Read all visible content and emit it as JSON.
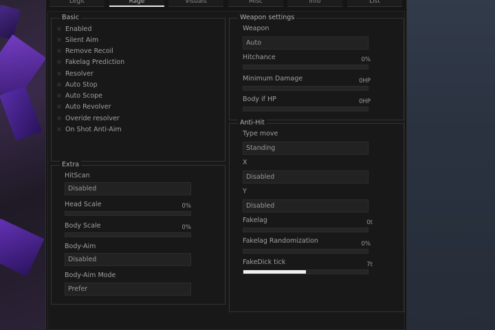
{
  "tabs": [
    "Legit",
    "Rage",
    "Visuals",
    "Misc",
    "Info",
    "List"
  ],
  "active_tab": "Rage",
  "basic": {
    "title": "Basic",
    "items": [
      "Enabled",
      "Silent Aim",
      "Remove Recoil",
      "Fakelag Prediction",
      "Resolver",
      "Auto Stop",
      "Auto Scope",
      "Auto Revolver",
      "Overide resolver",
      "On Shot Anti-Aim"
    ]
  },
  "extra": {
    "title": "Extra",
    "hitscan_label": "HitScan",
    "hitscan_value": "Disabled",
    "head_scale_label": "Head Scale",
    "head_scale_value": "0%",
    "head_scale_fraction": 0,
    "body_scale_label": "Body Scale",
    "body_scale_value": "0%",
    "body_scale_fraction": 0,
    "body_aim_label": "Body-Aim",
    "body_aim_value": "Disabled",
    "body_aim_mode_label": "Body-Aim Mode",
    "body_aim_mode_value": "Prefer"
  },
  "weapon": {
    "title": "Weapon settings",
    "weapon_label": "Weapon",
    "weapon_value": "Auto",
    "hitchance_label": "Hitchance",
    "hitchance_value": "0%",
    "hitchance_fraction": 0,
    "min_damage_label": "Minimum Damage",
    "min_damage_value": "0HP",
    "min_damage_fraction": 0,
    "body_if_hp_label": "Body if HP",
    "body_if_hp_value": "0HP",
    "body_if_hp_fraction": 0
  },
  "antihit": {
    "title": "Anti-Hit",
    "type_move_label": "Type move",
    "type_move_value": "Standing",
    "x_label": "X",
    "x_value": "Disabled",
    "y_label": "Y",
    "y_value": "Disabled",
    "fakelag_label": "Fakelag",
    "fakelag_value": "0t",
    "fakelag_fraction": 0,
    "fakelag_rand_label": "Fakelag Randomization",
    "fakelag_rand_value": "0%",
    "fakelag_rand_fraction": 0,
    "fakedick_label": "FakeDick tick",
    "fakedick_value": "7t",
    "fakedick_fraction": 0.5
  },
  "colors": {
    "accent": "#f0f0f0",
    "panel": "#181818",
    "border": "#333333"
  }
}
